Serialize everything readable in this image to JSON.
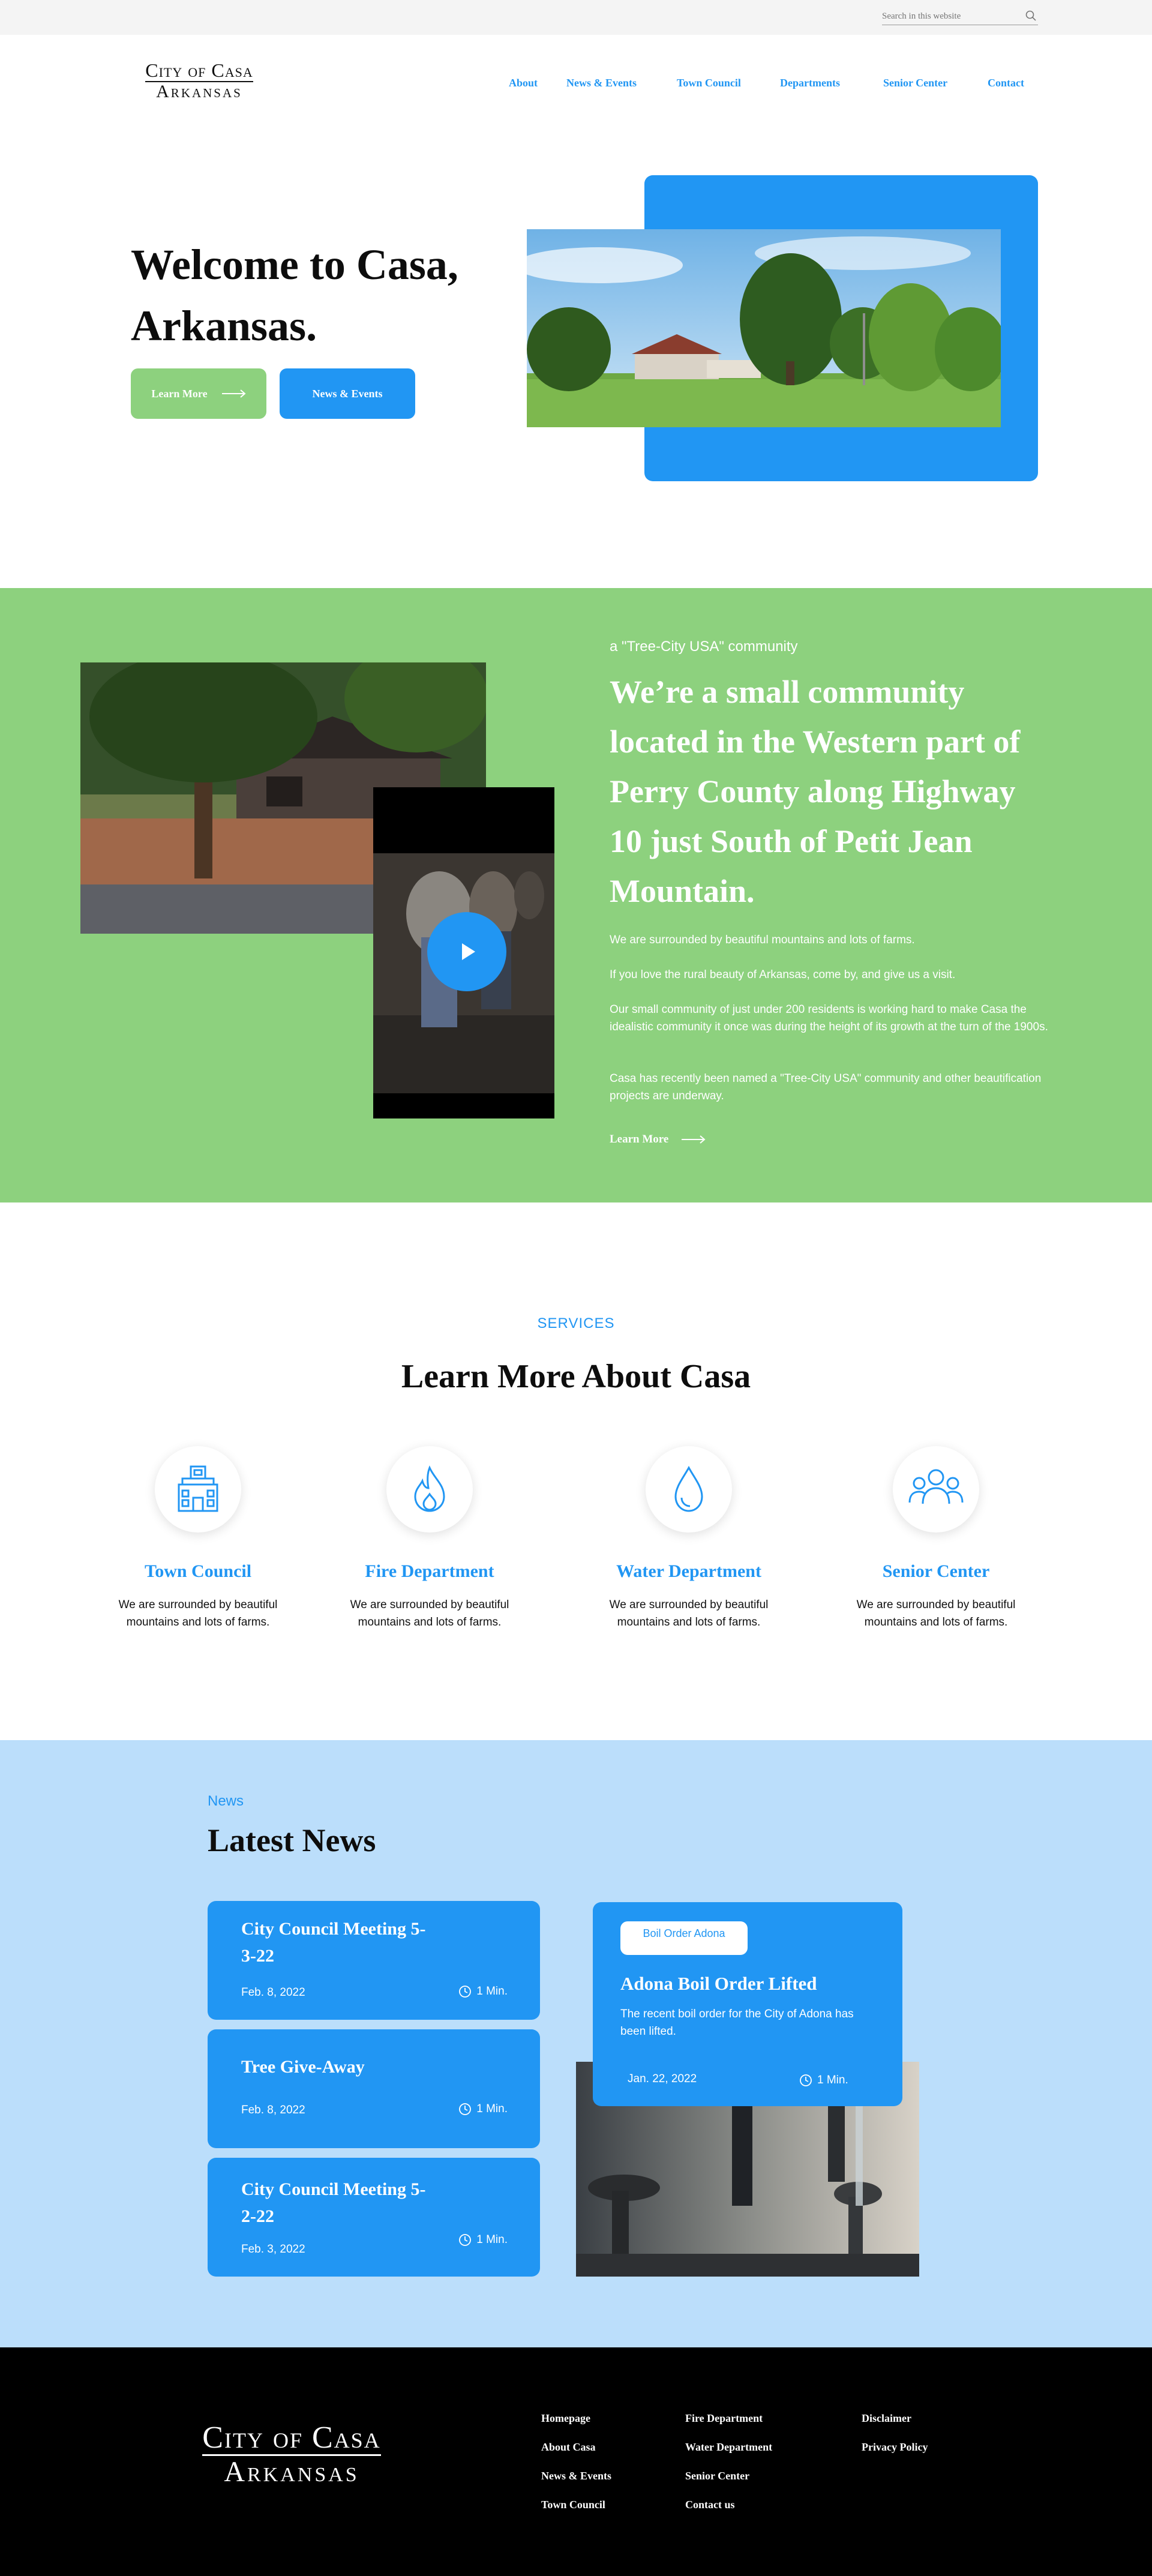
{
  "search": {
    "placeholder": "Search in this website",
    "icon": "search-icon"
  },
  "logo": {
    "line1": "City of Casa",
    "line2": "Arkansas"
  },
  "nav": [
    "About",
    "News & Events",
    "Town Council",
    "Departments",
    "Senior Center",
    "Contact"
  ],
  "hero": {
    "title": "Welcome to Casa, Arkansas.",
    "learn_more": "Learn More",
    "news_events": "News & Events"
  },
  "about": {
    "kicker": "a \"Tree-City USA\" community",
    "title": "We’re a small community located in the Western part of Perry County along Highway 10 just South of Petit Jean Mountain.",
    "paragraphs": [
      "We are surrounded by beautiful mountains and lots of farms.",
      "If you love the rural beauty of Arkansas, come by, and give us a visit.",
      "Our small community of just under 200 residents is working hard to make Casa the idealistic community it once was during the height of its growth at the turn of the 1900s.",
      "Casa has recently been named a \"Tree-City USA\" community and other beautification projects are underway."
    ],
    "link": "Learn More"
  },
  "services": {
    "kicker": "SERVICES",
    "title": "Learn More About Casa",
    "items": [
      {
        "name": "Town Council",
        "desc": "We are surrounded by beautiful mountains and lots of farms.",
        "icon": "town-hall-icon"
      },
      {
        "name": "Fire Department",
        "desc": "We are surrounded by beautiful mountains and lots of farms.",
        "icon": "flame-icon"
      },
      {
        "name": "Water Department",
        "desc": "We are surrounded by beautiful mountains and lots of farms.",
        "icon": "water-drop-icon"
      },
      {
        "name": "Senior Center",
        "desc": "We are surrounded by beautiful mountains and lots of farms.",
        "icon": "people-icon"
      }
    ]
  },
  "news": {
    "kicker": "News",
    "title": "Latest News",
    "cards": [
      {
        "title": "City Council Meeting 5-3-22",
        "date": "Feb. 8, 2022",
        "read": "1 Min."
      },
      {
        "title": "Tree Give-Away",
        "date": "Feb. 8, 2022",
        "read": "1 Min."
      },
      {
        "title": "City Council Meeting 5-2-22",
        "date": "Feb. 3, 2022",
        "read": "1 Min."
      }
    ],
    "featured": {
      "badge": "Boil Order Adona",
      "title": "Adona Boil Order Lifted",
      "desc": "The recent boil order for the City of Adona has been lifted.",
      "date": "Jan. 22, 2022",
      "read": "1 Min."
    }
  },
  "footer": {
    "logo": {
      "line1": "City of Casa",
      "line2": "Arkansas"
    },
    "col1": [
      "Homepage",
      "About Casa",
      "News & Events",
      "Town Council"
    ],
    "col2": [
      "Fire Department",
      "Water Department",
      "Senior Center",
      "Contact us"
    ],
    "col3": [
      "Disclaimer",
      "Privacy Policy"
    ]
  },
  "colors": {
    "blue": "#2196f3",
    "green": "#8dd17e",
    "light_blue": "#bbdefb",
    "black": "#000000"
  }
}
